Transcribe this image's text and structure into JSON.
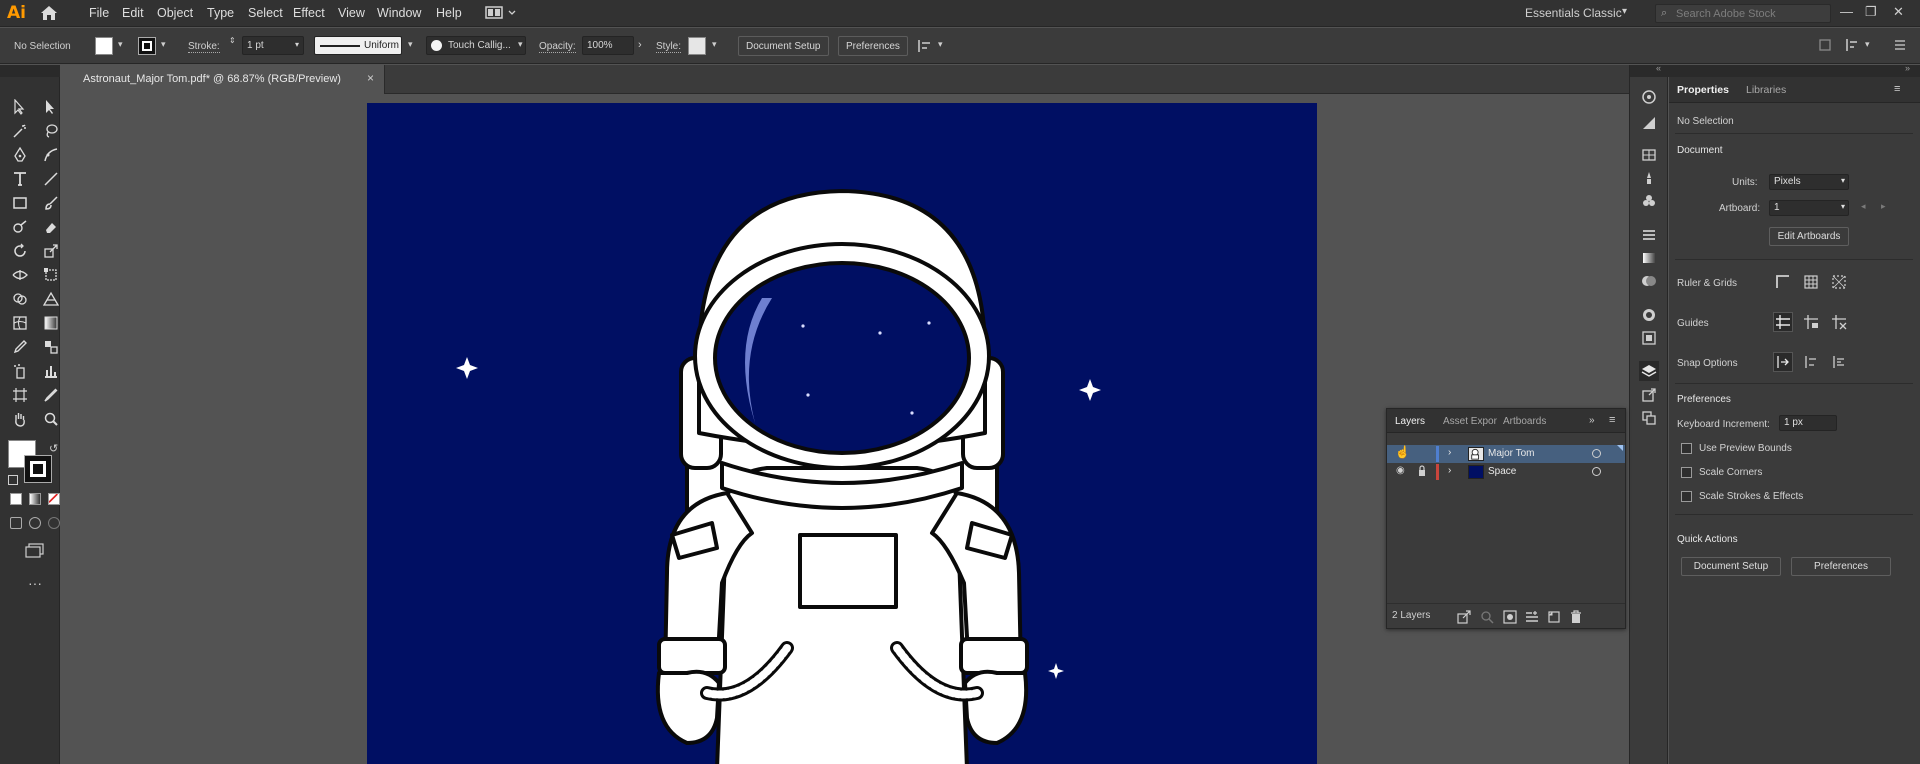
{
  "app": {
    "logo": "Ai",
    "menu": [
      "File",
      "Edit",
      "Object",
      "Type",
      "Select",
      "Effect",
      "View",
      "Window",
      "Help"
    ],
    "workspace": "Essentials Classic",
    "search_placeholder": "Search Adobe Stock",
    "window_controls": [
      "—",
      "❐",
      "✕"
    ]
  },
  "control_bar": {
    "selection": "No Selection",
    "stroke_label": "Stroke:",
    "stroke_weight": "1 pt",
    "profile": "Uniform",
    "brush": "Touch Callig...",
    "opacity_label": "Opacity:",
    "opacity": "100%",
    "style_label": "Style:",
    "document_setup": "Document Setup",
    "preferences": "Preferences"
  },
  "document": {
    "tab_title": "Astronaut_Major Tom.pdf* @ 68.87% (RGB/Preview)",
    "close": "×",
    "artboard_color": "#000f63"
  },
  "properties": {
    "tabs": [
      "Properties",
      "Libraries"
    ],
    "selection": "No Selection",
    "document_heading": "Document",
    "units_label": "Units:",
    "units_value": "Pixels",
    "artboard_label": "Artboard:",
    "artboard_value": "1",
    "edit_artboards": "Edit Artboards",
    "ruler_grids": "Ruler & Grids",
    "guides": "Guides",
    "snap_options": "Snap Options",
    "preferences_heading": "Preferences",
    "keyboard_increment_label": "Keyboard Increment:",
    "keyboard_increment_value": "1 px",
    "checkboxes": [
      "Use Preview Bounds",
      "Scale Corners",
      "Scale Strokes & Effects"
    ],
    "quick_actions": "Quick Actions",
    "document_setup": "Document Setup",
    "preferences_button": "Preferences"
  },
  "layers": {
    "tabs": [
      "Layers",
      "Asset Expor",
      "Artboards"
    ],
    "rows": [
      {
        "name": "Major Tom",
        "color": "#4f7fd0",
        "thumb": "#e6e6e6",
        "selected": true
      },
      {
        "name": "Space",
        "color": "#c9453c",
        "thumb": "#000f63",
        "selected": false
      }
    ],
    "count": "2 Layers"
  }
}
